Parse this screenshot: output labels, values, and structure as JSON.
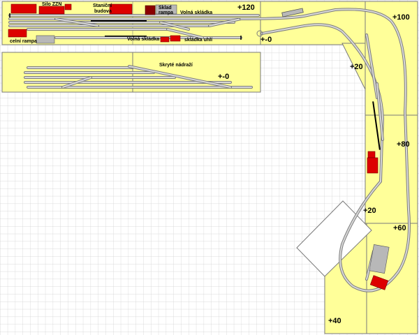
{
  "labels": {
    "silo": "Silo ZZN",
    "station_1": "Staniční",
    "station_2": "budova",
    "sklad_1": "Sklad",
    "sklad_2": "rampa",
    "volna_top": "Volná skládka",
    "celni": "celní rampa",
    "volna_bottom": "Volná skládka",
    "uhli": "skládka uhlí",
    "skryte": "Skryté nádraží"
  },
  "elevations": {
    "e120": "+120",
    "e0_a": "+-0",
    "e100": "+100",
    "e20_a": "+20",
    "e0_b": "+-0",
    "e80": "+80",
    "e20_b": "+20",
    "e60": "+60",
    "e40": "+40"
  },
  "colors": {
    "board": "#ffff99",
    "building_red": "#dd0000",
    "building_dark": "#8b0000",
    "building_grey": "#b8b8b8",
    "track": "#7d7d7d",
    "grid": "#cfcfcf"
  }
}
